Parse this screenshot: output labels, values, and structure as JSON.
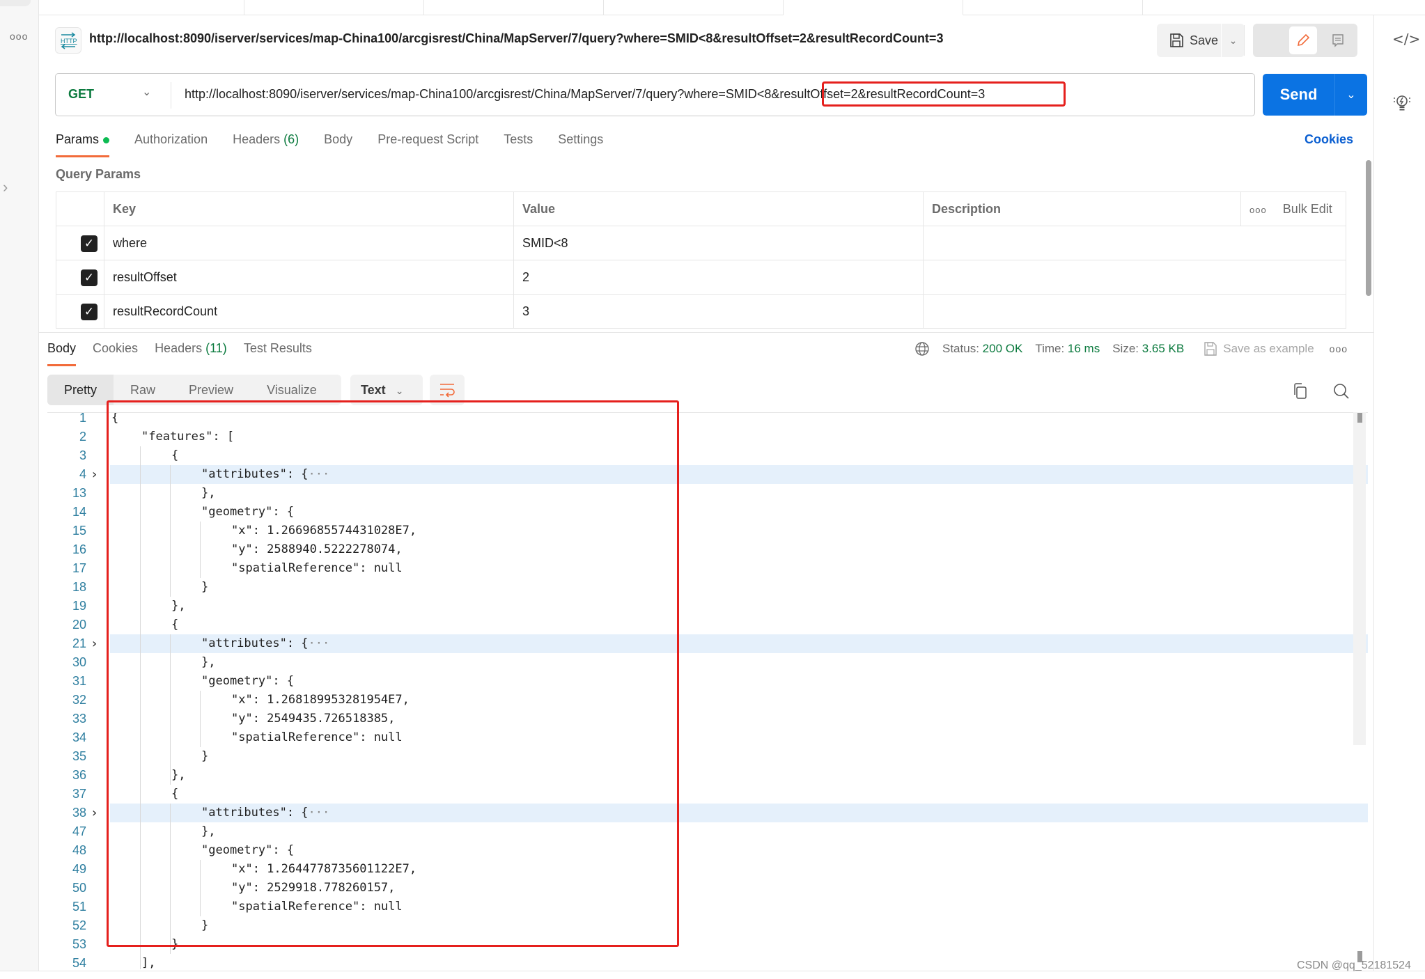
{
  "rail": {
    "more_icon": "more-horizontal-icon",
    "expand_icon": "chevron-right-icon"
  },
  "request": {
    "badge": "HTTP",
    "title": "http://localhost:8090/iserver/services/map-China100/arcgisrest/China/MapServer/7/query?where=SMID<8&resultOffset=2&resultRecordCount=3",
    "save_label": "Save",
    "method": "GET",
    "url": "http://localhost:8090/iserver/services/map-China100/arcgisrest/China/MapServer/7/query?where=SMID<8&resultOffset=2&resultRecordCount=3",
    "send_label": "Send"
  },
  "request_tabs": [
    {
      "label": "Params",
      "active": true,
      "dot": true
    },
    {
      "label": "Authorization"
    },
    {
      "label": "Headers",
      "count": "(6)"
    },
    {
      "label": "Body"
    },
    {
      "label": "Pre-request Script"
    },
    {
      "label": "Tests"
    },
    {
      "label": "Settings"
    }
  ],
  "cookies_label": "Cookies",
  "query_params": {
    "title": "Query Params",
    "headers": {
      "key": "Key",
      "value": "Value",
      "description": "Description",
      "bulk_edit": "Bulk Edit"
    },
    "rows": [
      {
        "checked": true,
        "key": "where",
        "value": "SMID<8",
        "description": ""
      },
      {
        "checked": true,
        "key": "resultOffset",
        "value": "2",
        "description": ""
      },
      {
        "checked": true,
        "key": "resultRecordCount",
        "value": "3",
        "description": ""
      }
    ]
  },
  "response_tabs": [
    {
      "label": "Body",
      "active": true
    },
    {
      "label": "Cookies"
    },
    {
      "label": "Headers",
      "count": "(11)"
    },
    {
      "label": "Test Results"
    }
  ],
  "response_meta": {
    "status_label": "Status:",
    "status": "200 OK",
    "time_label": "Time:",
    "time": "16 ms",
    "size_label": "Size:",
    "size": "3.65 KB",
    "save_example": "Save as example"
  },
  "view_options": [
    "Pretty",
    "Raw",
    "Preview",
    "Visualize"
  ],
  "active_view": "Pretty",
  "format": "Text",
  "code_lines": [
    {
      "n": "1",
      "text": "{",
      "indent": 0
    },
    {
      "n": "2",
      "text": "\"features\": [",
      "indent": 1
    },
    {
      "n": "3",
      "text": "{",
      "indent": 2
    },
    {
      "n": "4",
      "text": "\"attributes\": {",
      "indent": 3,
      "folded": true
    },
    {
      "n": "13",
      "text": "},",
      "indent": 3
    },
    {
      "n": "14",
      "text": "\"geometry\": {",
      "indent": 3
    },
    {
      "n": "15",
      "text": "\"x\": 1.2669685574431028E7,",
      "indent": 4
    },
    {
      "n": "16",
      "text": "\"y\": 2588940.5222278074,",
      "indent": 4
    },
    {
      "n": "17",
      "text": "\"spatialReference\": null",
      "indent": 4
    },
    {
      "n": "18",
      "text": "}",
      "indent": 3
    },
    {
      "n": "19",
      "text": "},",
      "indent": 2
    },
    {
      "n": "20",
      "text": "{",
      "indent": 2
    },
    {
      "n": "21",
      "text": "\"attributes\": {",
      "indent": 3,
      "folded": true
    },
    {
      "n": "30",
      "text": "},",
      "indent": 3
    },
    {
      "n": "31",
      "text": "\"geometry\": {",
      "indent": 3
    },
    {
      "n": "32",
      "text": "\"x\": 1.268189953281954E7,",
      "indent": 4
    },
    {
      "n": "33",
      "text": "\"y\": 2549435.726518385,",
      "indent": 4
    },
    {
      "n": "34",
      "text": "\"spatialReference\": null",
      "indent": 4
    },
    {
      "n": "35",
      "text": "}",
      "indent": 3
    },
    {
      "n": "36",
      "text": "},",
      "indent": 2
    },
    {
      "n": "37",
      "text": "{",
      "indent": 2
    },
    {
      "n": "38",
      "text": "\"attributes\": {",
      "indent": 3,
      "folded": true
    },
    {
      "n": "47",
      "text": "},",
      "indent": 3
    },
    {
      "n": "48",
      "text": "\"geometry\": {",
      "indent": 3
    },
    {
      "n": "49",
      "text": "\"x\": 1.2644778735601122E7,",
      "indent": 4
    },
    {
      "n": "50",
      "text": "\"y\": 2529918.778260157,",
      "indent": 4
    },
    {
      "n": "51",
      "text": "\"spatialReference\": null",
      "indent": 4
    },
    {
      "n": "52",
      "text": "}",
      "indent": 3
    },
    {
      "n": "53",
      "text": "}",
      "indent": 2
    },
    {
      "n": "54",
      "text": "],",
      "indent": 1
    }
  ],
  "fold_ellipsis": "···",
  "watermark": "CSDN @qq_52181524",
  "colors": {
    "send": "#0b73e3",
    "accent": "#f26b3a",
    "ok": "#0b7a3e",
    "highlight_box": "#e5201d",
    "link": "#0b5fd1"
  }
}
